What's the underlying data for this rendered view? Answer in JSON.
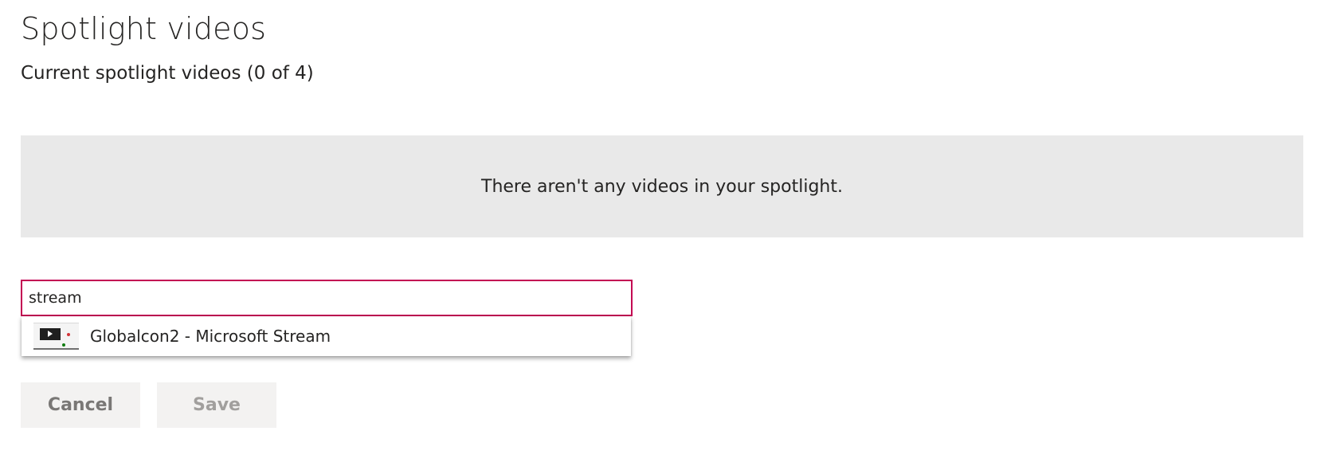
{
  "header": {
    "title": "Spotlight videos",
    "subtitle": "Current spotlight videos (0 of 4)"
  },
  "empty_state": {
    "message": "There aren't any videos in your spotlight."
  },
  "search": {
    "value": "stream",
    "placeholder": ""
  },
  "suggestions": [
    {
      "label": "Globalcon2 - Microsoft Stream",
      "icon": "video-thumbnail-icon"
    }
  ],
  "actions": {
    "cancel_label": "Cancel",
    "save_label": "Save"
  },
  "colors": {
    "accent": "#c30052",
    "panel_bg": "#e9e9e9",
    "button_bg": "#f3f2f1"
  }
}
